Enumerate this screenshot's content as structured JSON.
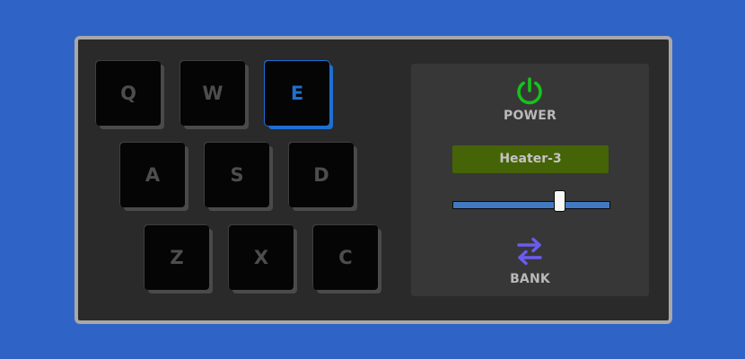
{
  "pads": [
    {
      "key": "Q",
      "active": false
    },
    {
      "key": "W",
      "active": false
    },
    {
      "key": "E",
      "active": true
    },
    {
      "key": "A",
      "active": false
    },
    {
      "key": "S",
      "active": false
    },
    {
      "key": "D",
      "active": false
    },
    {
      "key": "Z",
      "active": false
    },
    {
      "key": "X",
      "active": false
    },
    {
      "key": "C",
      "active": false
    }
  ],
  "controls": {
    "power": {
      "label": "POWER",
      "icon": "power-icon",
      "on": true,
      "color": "#17c21a"
    },
    "display": {
      "text": "Heater-3",
      "background": "#456307"
    },
    "volume": {
      "value": 0.68
    },
    "bank": {
      "label": "BANK",
      "icon": "swap-arrows-icon",
      "color": "#6b5cf0"
    }
  },
  "colors": {
    "accent": "#1e6fd0",
    "background": "#2f64c6"
  }
}
